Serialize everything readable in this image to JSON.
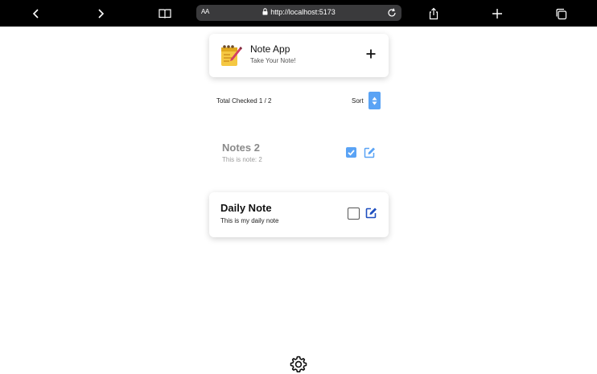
{
  "browser": {
    "text_size_label": "AA",
    "url": "http://localhost:5173"
  },
  "app": {
    "title": "Note App",
    "subtitle": "Take Your Note!"
  },
  "toolbar": {
    "summary": "Total Checked 1 / 2",
    "sort_label": "Sort"
  },
  "notes": [
    {
      "title": "Notes 2",
      "description": "This is note: 2",
      "checked": true
    },
    {
      "title": "Daily Note",
      "description": "This is my daily note",
      "checked": false
    }
  ],
  "colors": {
    "accent": "#5aa3f5",
    "edit_icon_checked": "#5aa3f5",
    "edit_icon_unchecked": "#1e4fbf"
  },
  "icons": [
    "back-icon",
    "forward-icon",
    "book-icon",
    "lock-icon",
    "reload-icon",
    "share-icon",
    "plus-icon",
    "tabs-icon",
    "notepad-icon",
    "add-icon",
    "sort-icon",
    "check-icon",
    "edit-icon",
    "gear-icon"
  ]
}
